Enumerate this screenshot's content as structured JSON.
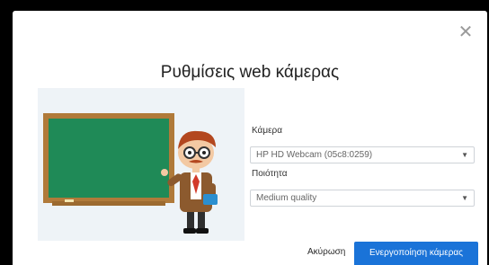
{
  "dialog": {
    "title": "Ρυθμίσεις web κάμερας",
    "close_icon": "close-icon"
  },
  "camera": {
    "label": "Κάμερα",
    "selected": "HP HD Webcam (05c8:0259)"
  },
  "quality": {
    "label": "Ποιότητα",
    "selected": "Medium quality"
  },
  "actions": {
    "cancel_label": "Ακύρωση",
    "primary_label": "Ενεργοποίηση κάμερας"
  },
  "colors": {
    "primary": "#1a73d8",
    "board": "#1f8a57",
    "board_frame": "#b07a3a"
  }
}
